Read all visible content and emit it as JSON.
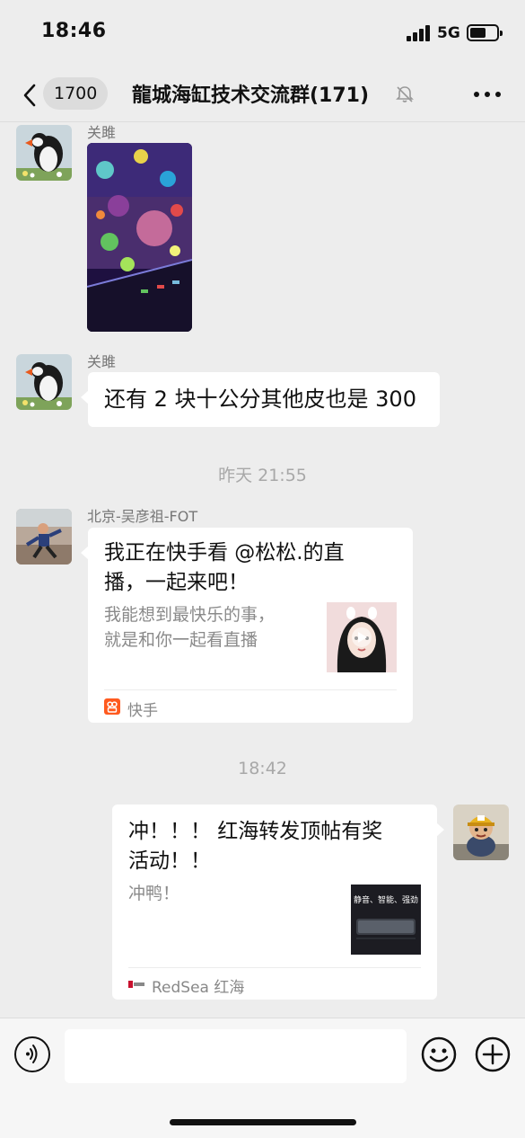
{
  "status_bar": {
    "time": "18:46",
    "network": "5G"
  },
  "nav": {
    "unread_count": "1700",
    "title": "龍城海缸技术交流群(171)"
  },
  "messages": [
    {
      "sender": "关雎",
      "type": "image"
    },
    {
      "sender": "关雎",
      "type": "text",
      "text": "还有 2 块十公分其他皮也是 300"
    },
    {
      "type": "time",
      "text": "昨天 21:55"
    },
    {
      "sender": "北京-吴彦祖-FOT",
      "type": "card",
      "title_line1": "我正在快手看 @松松.的直",
      "title_line2": "播，一起来吧！",
      "desc_line1": "我能想到最快乐的事，",
      "desc_line2": "就是和你一起看直播",
      "source": "快手"
    },
    {
      "type": "time",
      "text": "18:42"
    },
    {
      "sender": "self",
      "type": "card",
      "title_line1": "冲！！！ 红海转发顶帖有奖",
      "title_line2": "活动！！",
      "desc_line1": "冲鸭！",
      "thumb_text": "静音、智能、强劲",
      "source": "RedSea 红海"
    }
  ],
  "colors": {
    "background": "#ededed",
    "bubble": "#ffffff",
    "kuaishou": "#ff5a1f",
    "redsea": "#c8102e"
  }
}
